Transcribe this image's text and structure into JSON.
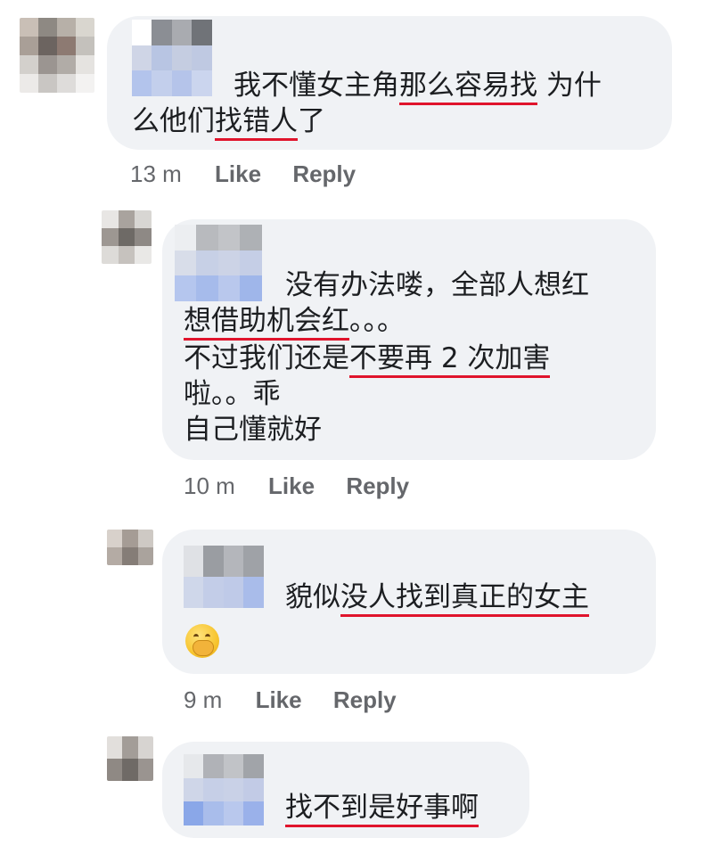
{
  "comments": [
    {
      "lines": [
        [
          {
            "t": "我不懂女主角"
          },
          {
            "t": "那么容易找",
            "u": true
          },
          {
            "t": " 为什"
          }
        ],
        [
          {
            "t": "么他们"
          },
          {
            "t": "找错人",
            "u": true
          },
          {
            "t": "了"
          }
        ]
      ],
      "time": "13 m",
      "like": "Like",
      "reply": "Reply"
    },
    {
      "lines": [
        [
          {
            "t": "没有办法喽，全部人想红"
          }
        ],
        [
          {
            "t": "想借助机会红",
            "u": true
          },
          {
            "t": "。。。"
          }
        ],
        [
          {
            "t": "不过我们还是"
          },
          {
            "t": "不要再 2 次加害",
            "u": true
          }
        ],
        [
          {
            "t": "啦。。乖"
          }
        ],
        [
          {
            "t": "自己懂就好"
          }
        ]
      ],
      "time": "10 m",
      "like": "Like",
      "reply": "Reply"
    },
    {
      "lines": [
        [
          {
            "t": "貌似"
          },
          {
            "t": "没人找到真正的女主",
            "u": true
          }
        ]
      ],
      "emoji": "face-with-hand-over-mouth",
      "time": "9 m",
      "like": "Like",
      "reply": "Reply"
    },
    {
      "lines": [
        [
          {
            "t": "找不到是好事啊",
            "u": true
          }
        ]
      ]
    }
  ],
  "colors": {
    "bubble": "#f0f2f5",
    "underline": "#e0142c",
    "meta": "#65676b",
    "text": "#1c1e21"
  }
}
